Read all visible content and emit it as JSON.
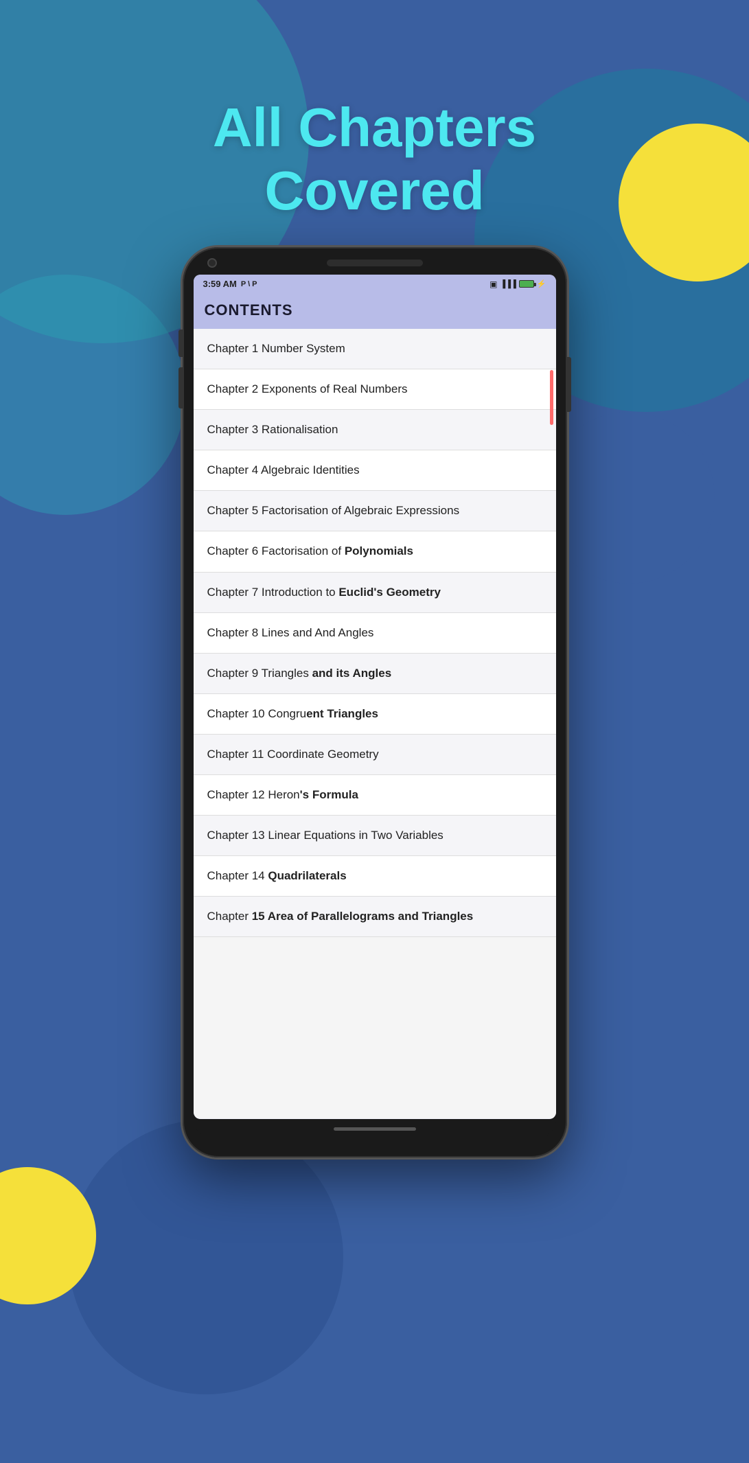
{
  "background": {
    "color": "#3a5fa0"
  },
  "heading": {
    "line1": "All Chapters",
    "line2": "Covered",
    "color": "#4de8f0"
  },
  "statusBar": {
    "time": "3:59 AM",
    "icons": "P \\ P",
    "rightIcons": "📶 🔋"
  },
  "contentsHeader": {
    "label": "CONTENTS"
  },
  "chapters": [
    {
      "text": "Chapter 1 Number System",
      "bold": ""
    },
    {
      "text": "Chapter 2 Exponents of Real Numbers",
      "bold": ""
    },
    {
      "text": "Chapter 3 Rationalisation",
      "bold": ""
    },
    {
      "text": "Chapter 4 Algebraic Identities",
      "bold": ""
    },
    {
      "text": "Chapter 5 Factorisation of Algebraic Expressions",
      "bold": "Algebraic Expressions"
    },
    {
      "text": "Chapter 6 Factorisation of Polynomials",
      "bold": "Polynomials"
    },
    {
      "text": "Chapter 7 Introduction to Euclid's Geometry",
      "bold": "Euclid's Geometry"
    },
    {
      "text": "Chapter 8 Lines and And Angles",
      "bold": ""
    },
    {
      "text": "Chapter 9 Triangles and its Angles",
      "bold": "its Angles"
    },
    {
      "text": "Chapter 10 Congruent Triangles",
      "bold": "ent Triangles"
    },
    {
      "text": "Chapter 11 Coordinate Geometry",
      "bold": ""
    },
    {
      "text": "Chapter 12 Heron's Formula",
      "bold": "'s Formula"
    },
    {
      "text": "Chapter 13 Linear Equations in Two Variables",
      "bold": ""
    },
    {
      "text": "Chapter 14 Quadrilaterals",
      "bold": "Quadrilaterals"
    },
    {
      "text": "Chapter 15 Area of Parallelograms and Triangles",
      "bold": "15 Area of Parallelograms and Triangles"
    }
  ]
}
